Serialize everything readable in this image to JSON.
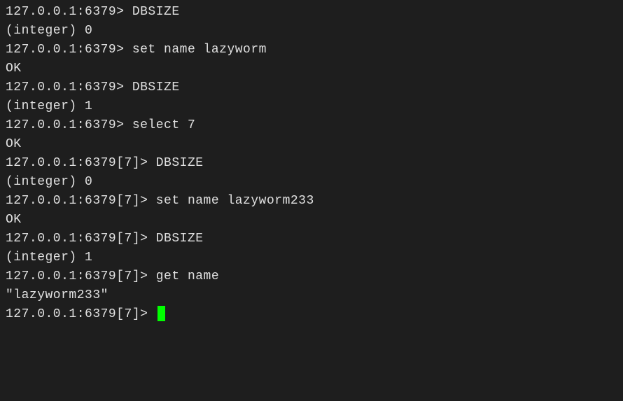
{
  "lines": [
    {
      "prompt": "127.0.0.1:6379> ",
      "command": "DBSIZE"
    },
    {
      "output": "(integer) 0"
    },
    {
      "prompt": "127.0.0.1:6379> ",
      "command": "set name lazyworm"
    },
    {
      "output": "OK"
    },
    {
      "prompt": "127.0.0.1:6379> ",
      "command": "DBSIZE"
    },
    {
      "output": "(integer) 1"
    },
    {
      "prompt": "127.0.0.1:6379> ",
      "command": "select 7"
    },
    {
      "output": "OK"
    },
    {
      "prompt": "127.0.0.1:6379[7]> ",
      "command": "DBSIZE"
    },
    {
      "output": "(integer) 0"
    },
    {
      "prompt": "127.0.0.1:6379[7]> ",
      "command": "set name lazyworm233"
    },
    {
      "output": "OK"
    },
    {
      "prompt": "127.0.0.1:6379[7]> ",
      "command": "DBSIZE"
    },
    {
      "output": "(integer) 1"
    },
    {
      "prompt": "127.0.0.1:6379[7]> ",
      "command": "get name"
    },
    {
      "output": "\"lazyworm233\""
    },
    {
      "prompt": "127.0.0.1:6379[7]> ",
      "command": "",
      "cursor": true
    }
  ]
}
